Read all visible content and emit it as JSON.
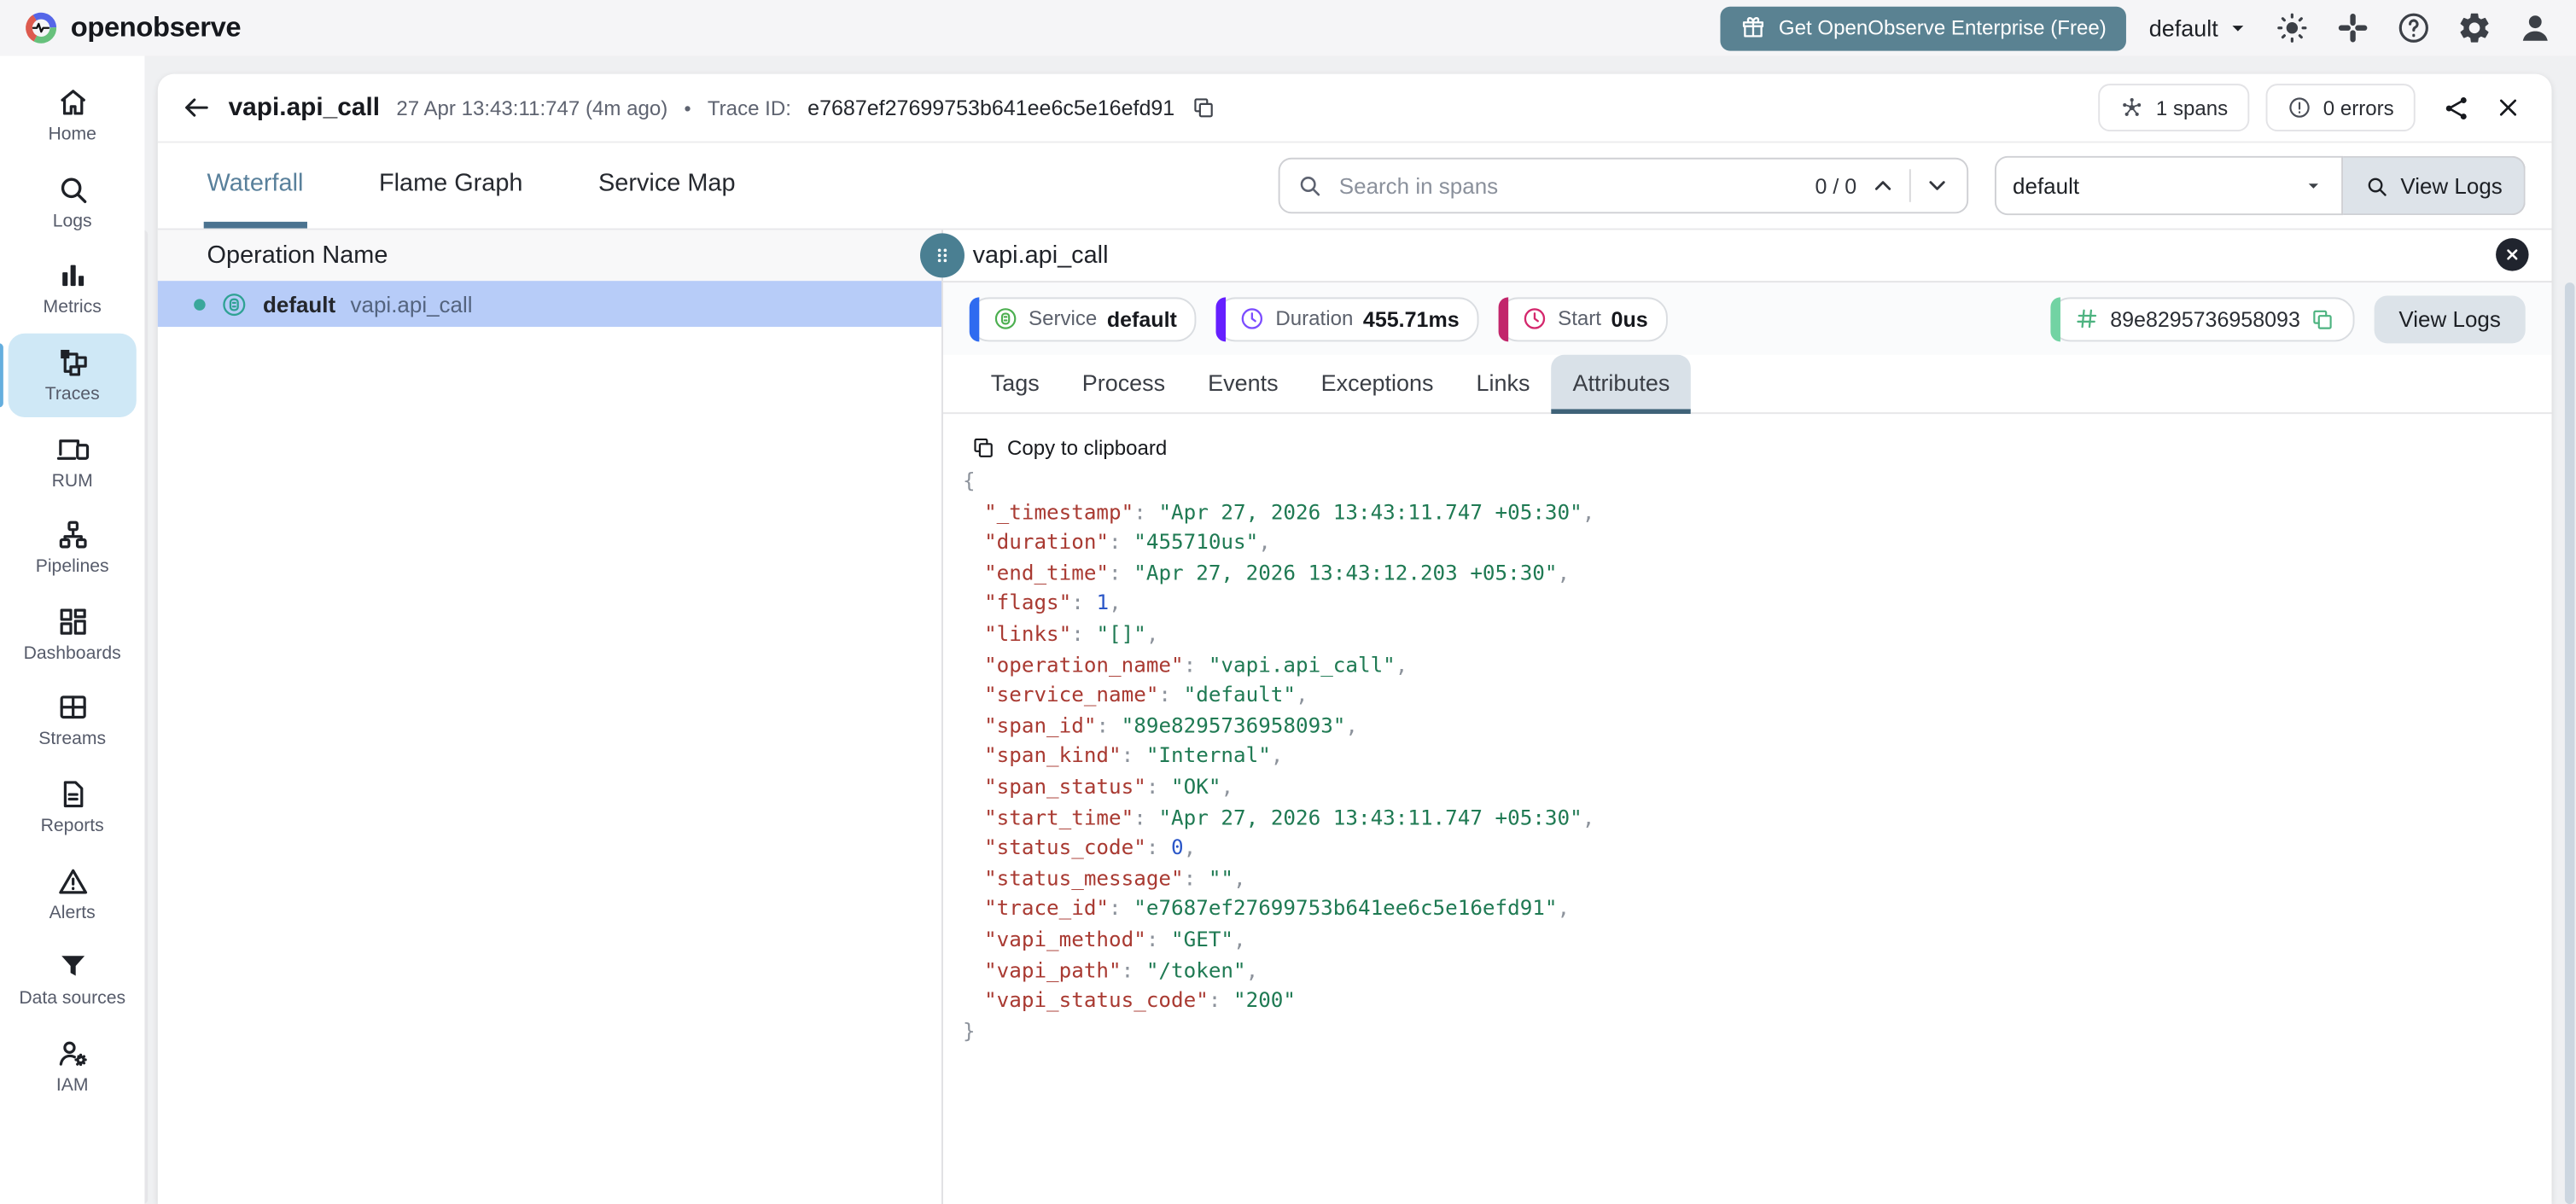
{
  "header": {
    "logo_text": "openobserve",
    "enterprise_button": "Get OpenObserve Enterprise (Free)",
    "org_selector": "default",
    "actions": [
      {
        "icon": "sun",
        "name": "theme-toggle"
      },
      {
        "icon": "slack",
        "name": "slack"
      },
      {
        "icon": "help",
        "name": "help"
      },
      {
        "icon": "gear",
        "name": "settings"
      },
      {
        "icon": "person",
        "name": "profile"
      }
    ]
  },
  "sidebar": {
    "items": [
      {
        "label": "Home",
        "icon": "home",
        "active": false
      },
      {
        "label": "Logs",
        "icon": "search",
        "active": false
      },
      {
        "label": "Metrics",
        "icon": "bars",
        "active": false
      },
      {
        "label": "Traces",
        "icon": "trace",
        "active": true
      },
      {
        "label": "RUM",
        "icon": "devices",
        "active": false
      },
      {
        "label": "Pipelines",
        "icon": "pipeline",
        "active": false
      },
      {
        "label": "Dashboards",
        "icon": "dashboard",
        "active": false
      },
      {
        "label": "Streams",
        "icon": "table",
        "active": false
      },
      {
        "label": "Reports",
        "icon": "report",
        "active": false
      },
      {
        "label": "Alerts",
        "icon": "warning",
        "active": false
      },
      {
        "label": "Data sources",
        "icon": "funnel",
        "active": false
      },
      {
        "label": "IAM",
        "icon": "iam",
        "active": false
      }
    ]
  },
  "trace_header": {
    "title": "vapi.api_call",
    "timestamp": "27 Apr 13:43:11:747 (4m ago)",
    "separator": "•",
    "trace_id_label": "Trace ID:",
    "trace_id": "e7687ef27699753b641ee6c5e16efd91",
    "spans_badge": "1 spans",
    "errors_badge": "0 errors"
  },
  "toolbar": {
    "tabs": [
      {
        "label": "Waterfall",
        "active": true
      },
      {
        "label": "Flame Graph",
        "active": false
      },
      {
        "label": "Service Map",
        "active": false
      }
    ],
    "search_placeholder": "Search in spans",
    "search_counter": "0 / 0",
    "stream_selector": "default",
    "view_logs_label": "View Logs"
  },
  "waterfall": {
    "column_header": "Operation Name",
    "row": {
      "service": "default",
      "operation": "vapi.api_call"
    }
  },
  "span_panel": {
    "title": "vapi.api_call",
    "chips": [
      {
        "label": "Service",
        "value": "default",
        "icon": "service",
        "accent": "#2f6bf0",
        "icon_color": "#4caf50"
      },
      {
        "label": "Duration",
        "value": "455.71ms",
        "icon": "clock",
        "accent": "#651fff",
        "icon_color": "#7c4dff"
      },
      {
        "label": "Start",
        "value": "0us",
        "icon": "clock",
        "accent": "#c2266b",
        "icon_color": "#d4286d"
      }
    ],
    "span_id_chip": {
      "value": "89e8295736958093",
      "accent": "#72d3a3",
      "icon_color": "#4db380"
    },
    "view_logs_label": "View Logs",
    "tabs": [
      "Tags",
      "Process",
      "Events",
      "Exceptions",
      "Links",
      "Attributes"
    ],
    "active_tab": "Attributes",
    "copy_label": "Copy to clipboard",
    "attributes": [
      {
        "key": "_timestamp",
        "value": "Apr 27, 2026 13:43:11.747 +05:30",
        "type": "string"
      },
      {
        "key": "duration",
        "value": "455710us",
        "type": "string"
      },
      {
        "key": "end_time",
        "value": "Apr 27, 2026 13:43:12.203 +05:30",
        "type": "string"
      },
      {
        "key": "flags",
        "value": "1",
        "type": "number"
      },
      {
        "key": "links",
        "value": "[]",
        "type": "string"
      },
      {
        "key": "operation_name",
        "value": "vapi.api_call",
        "type": "string"
      },
      {
        "key": "service_name",
        "value": "default",
        "type": "string"
      },
      {
        "key": "span_id",
        "value": "89e8295736958093",
        "type": "string"
      },
      {
        "key": "span_kind",
        "value": "Internal",
        "type": "string"
      },
      {
        "key": "span_status",
        "value": "OK",
        "type": "string"
      },
      {
        "key": "start_time",
        "value": "Apr 27, 2026 13:43:11.747 +05:30",
        "type": "string"
      },
      {
        "key": "status_code",
        "value": "0",
        "type": "number"
      },
      {
        "key": "status_message",
        "value": "",
        "type": "string"
      },
      {
        "key": "trace_id",
        "value": "e7687ef27699753b641ee6c5e16efd91",
        "type": "string"
      },
      {
        "key": "vapi_method",
        "value": "GET",
        "type": "string"
      },
      {
        "key": "vapi_path",
        "value": "/token",
        "type": "string"
      },
      {
        "key": "vapi_status_code",
        "value": "200",
        "type": "string"
      }
    ]
  },
  "colors": {
    "enterprise_button": "#5a8292",
    "selected_row": "#b7ccf8",
    "sidebar_active": "#cfe8f6",
    "active_tab_underline": "#4b7390",
    "attributes_tab_bg": "#d9e1e8",
    "drag_handle": "#4a7f92",
    "json_key": "#a93a32",
    "json_string": "#1f7a53",
    "json_number": "#2b57c8"
  }
}
